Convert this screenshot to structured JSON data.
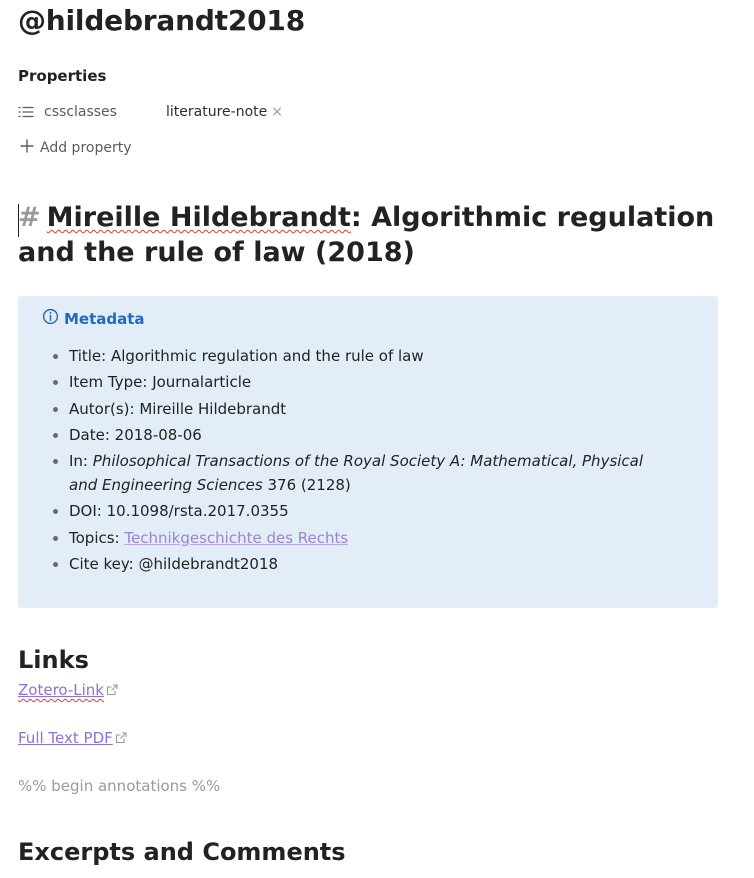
{
  "note": {
    "title": "@hildebrandt2018"
  },
  "properties": {
    "heading": "Properties",
    "items": [
      {
        "key": "cssclasses",
        "value": "literature-note",
        "icon": "list-icon"
      }
    ],
    "add_label": "Add property"
  },
  "heading1": {
    "marker": "#",
    "name": "Mireille Hildebrandt",
    "rest": ": Algorithmic regulation and the rule of law (2018)"
  },
  "callout": {
    "icon": "info-icon",
    "title": "Metadata",
    "title_color": "#1f6ac1",
    "background": "#e3edf8",
    "items": {
      "title": "Title: Algorithmic regulation and the rule of law",
      "item_type": "Item Type: Journalarticle",
      "authors": "Autor(s): Mireille Hildebrandt",
      "date": "Date: 2018-08-06",
      "in_prefix": "In: ",
      "in_journal": "Philosophical Transactions of the Royal Society A: Mathematical, Physical and Engineering Sciences",
      "in_suffix": " 376 (2128)",
      "doi": "DOI: 10.1098/rsta.2017.0355",
      "topics_prefix": "Topics: ",
      "topics_link": "Technikgeschichte des Rechts",
      "cite_key": "Cite key: @hildebrandt2018"
    }
  },
  "links_section": {
    "heading": "Links",
    "zotero": "Zotero-Link",
    "fulltext": "Full Text PDF",
    "link_color": "#8f6fd8"
  },
  "annotations_comment": "%% begin annotations %%",
  "excerpts_heading": "Excerpts and Comments"
}
